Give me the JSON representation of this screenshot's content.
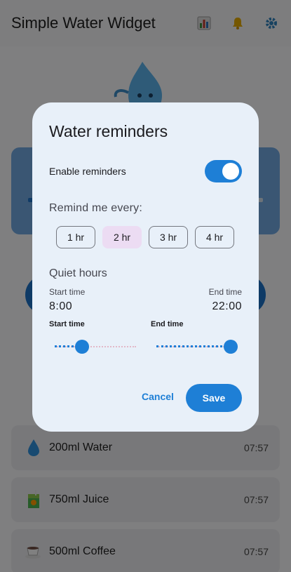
{
  "app": {
    "title": "Simple Water Widget",
    "icons": [
      "bar-chart-icon",
      "bell-icon",
      "gear-icon"
    ]
  },
  "log": [
    {
      "label": "200ml Water",
      "time": "07:57",
      "icon": "water-drop-icon"
    },
    {
      "label": "750ml Juice",
      "time": "07:57",
      "icon": "juice-box-icon"
    },
    {
      "label": "500ml Coffee",
      "time": "07:57",
      "icon": "coffee-cup-icon"
    }
  ],
  "dialog": {
    "title": "Water reminders",
    "enable_label": "Enable reminders",
    "enabled": true,
    "remind_label": "Remind me every:",
    "intervals": [
      "1 hr",
      "2 hr",
      "3 hr",
      "4 hr"
    ],
    "selected_interval": "2 hr",
    "quiet_label": "Quiet hours",
    "start_caption": "Start time",
    "start_value": "8:00",
    "end_caption": "End time",
    "end_value": "22:00",
    "start_slider_caption": "Start time",
    "end_slider_caption": "End time",
    "start_slider_fraction": 0.333,
    "end_slider_fraction": 0.917,
    "cancel_label": "Cancel",
    "save_label": "Save"
  },
  "colors": {
    "accent": "#1e7fd6",
    "selected_chip": "#ecdcf3",
    "dialog_bg": "#e8f0f9"
  }
}
